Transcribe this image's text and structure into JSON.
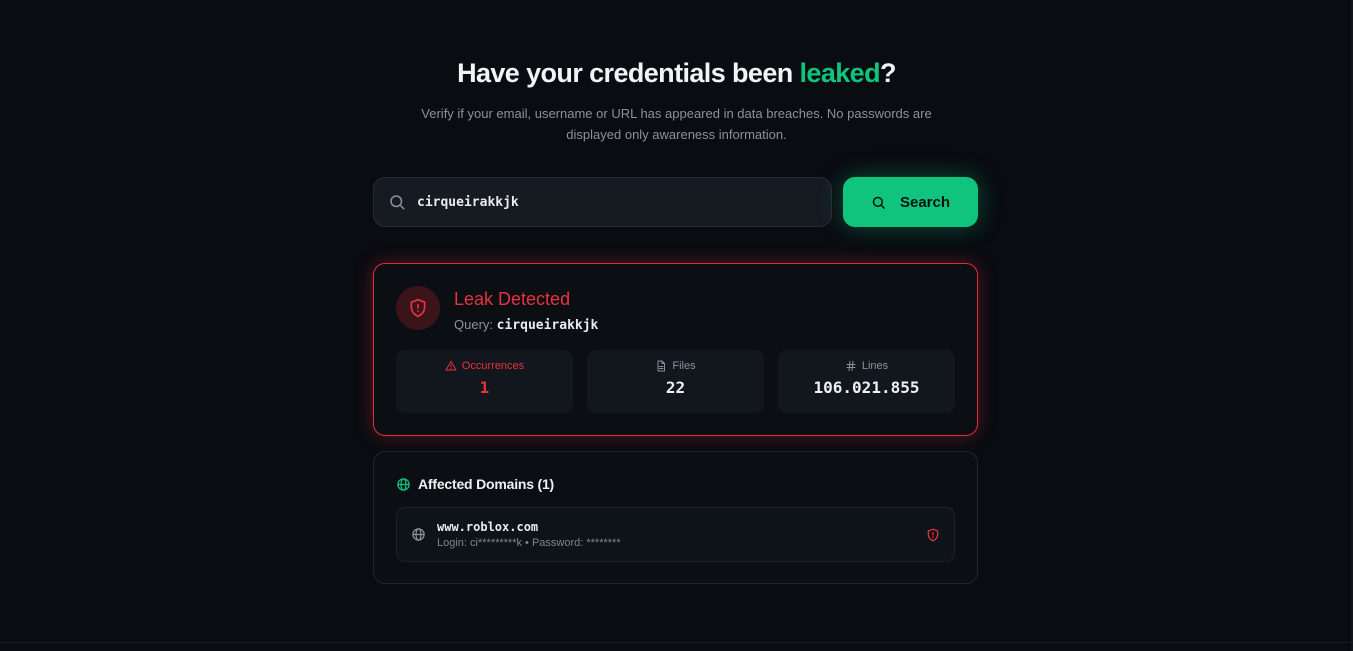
{
  "hero": {
    "title_before": "Have your credentials been ",
    "title_accent": "leaked",
    "title_after": "?",
    "subtitle": "Verify if your email, username or URL has appeared in data breaches. No passwords are displayed only awareness information."
  },
  "search": {
    "value": "cirqueirakkjk",
    "button_label": "Search"
  },
  "result": {
    "status": "Leak Detected",
    "query_label": "Query:",
    "query_value": "cirqueirakkjk",
    "stats": [
      {
        "label": "Occurrences",
        "value": "1",
        "icon": "alert-triangle-icon"
      },
      {
        "label": "Files",
        "value": "22",
        "icon": "file-icon"
      },
      {
        "label": "Lines",
        "value": "106.021.855",
        "icon": "hash-icon"
      }
    ]
  },
  "domains": {
    "title": "Affected Domains (1)",
    "items": [
      {
        "domain": "www.roblox.com",
        "credentials": "Login: ci*********k • Password: ********"
      }
    ]
  },
  "colors": {
    "accent": "#10c47e",
    "danger": "#e8323f",
    "background": "#090c11"
  }
}
